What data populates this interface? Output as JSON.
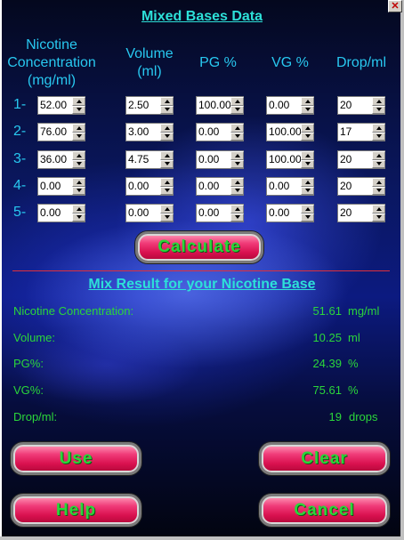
{
  "window": {
    "close_glyph": "✕"
  },
  "mixed_bases": {
    "title": "Mixed Bases Data",
    "headers": {
      "nicotine": [
        "Nicotine",
        "Concentration",
        "(mg/ml)"
      ],
      "volume": [
        "Volume",
        "(ml)"
      ],
      "pg": "PG %",
      "vg": "VG %",
      "drop": "Drop/ml"
    },
    "rows": [
      {
        "label": "1-",
        "nicotine": "52.00",
        "volume": "2.50",
        "pg": "100.00",
        "vg": "0.00",
        "drop": "20"
      },
      {
        "label": "2-",
        "nicotine": "76.00",
        "volume": "3.00",
        "pg": "0.00",
        "vg": "100.00",
        "drop": "17"
      },
      {
        "label": "3-",
        "nicotine": "36.00",
        "volume": "4.75",
        "pg": "0.00",
        "vg": "100.00",
        "drop": "20"
      },
      {
        "label": "4-",
        "nicotine": "0.00",
        "volume": "0.00",
        "pg": "0.00",
        "vg": "0.00",
        "drop": "20"
      },
      {
        "label": "5-",
        "nicotine": "0.00",
        "volume": "0.00",
        "pg": "0.00",
        "vg": "0.00",
        "drop": "20"
      }
    ]
  },
  "buttons": {
    "calculate": "Calculate",
    "use": "Use",
    "clear": "Clear",
    "help": "Help",
    "cancel": "Cancel"
  },
  "result": {
    "title": "Mix Result for your Nicotine Base",
    "items": [
      {
        "label": "Nicotine Concentration:",
        "value": "51.61",
        "unit": "mg/ml"
      },
      {
        "label": "Volume:",
        "value": "10.25",
        "unit": "ml"
      },
      {
        "label": "PG%:",
        "value": "24.39",
        "unit": "%"
      },
      {
        "label": "VG%:",
        "value": "75.61",
        "unit": "%"
      },
      {
        "label": "Drop/ml:",
        "value": "19",
        "unit": "drops"
      }
    ]
  },
  "colors": {
    "title_cyan": "#2de0d8",
    "header_blue": "#28c8f0",
    "result_green": "#2bd63a",
    "button_pink": "#e8205e",
    "divider_red": "#e0303a"
  }
}
